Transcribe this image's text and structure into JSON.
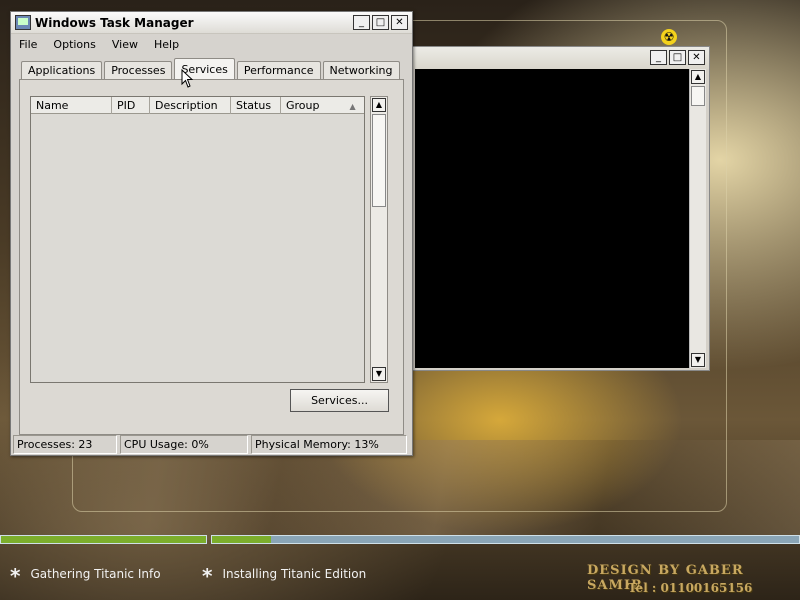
{
  "task_manager": {
    "title": "Windows Task Manager",
    "menu": [
      "File",
      "Options",
      "View",
      "Help"
    ],
    "tabs": [
      "Applications",
      "Processes",
      "Services",
      "Performance",
      "Networking"
    ],
    "active_tab": "Services",
    "columns": [
      "Name",
      "PID",
      "Description",
      "Status",
      "Group"
    ],
    "services_button": "Services...",
    "status": {
      "processes": "Processes: 23",
      "cpu": "CPU Usage: 0%",
      "memory": "Physical Memory: 13%"
    },
    "window_buttons": {
      "minimize": "_",
      "maximize": "□",
      "close": "✕"
    }
  },
  "setup": {
    "step1": {
      "label": "Gathering Titanic Info",
      "progress": 1.0
    },
    "step2": {
      "label": "Installing Titanic Edition",
      "progress": 0.1
    },
    "credit": "DESIGN BY GABER SAMIR",
    "credit_phone": "Tel : 01100165156"
  },
  "colors": {
    "progress_fill": "#7cae2c",
    "progress_track": "#8aa5b6"
  }
}
